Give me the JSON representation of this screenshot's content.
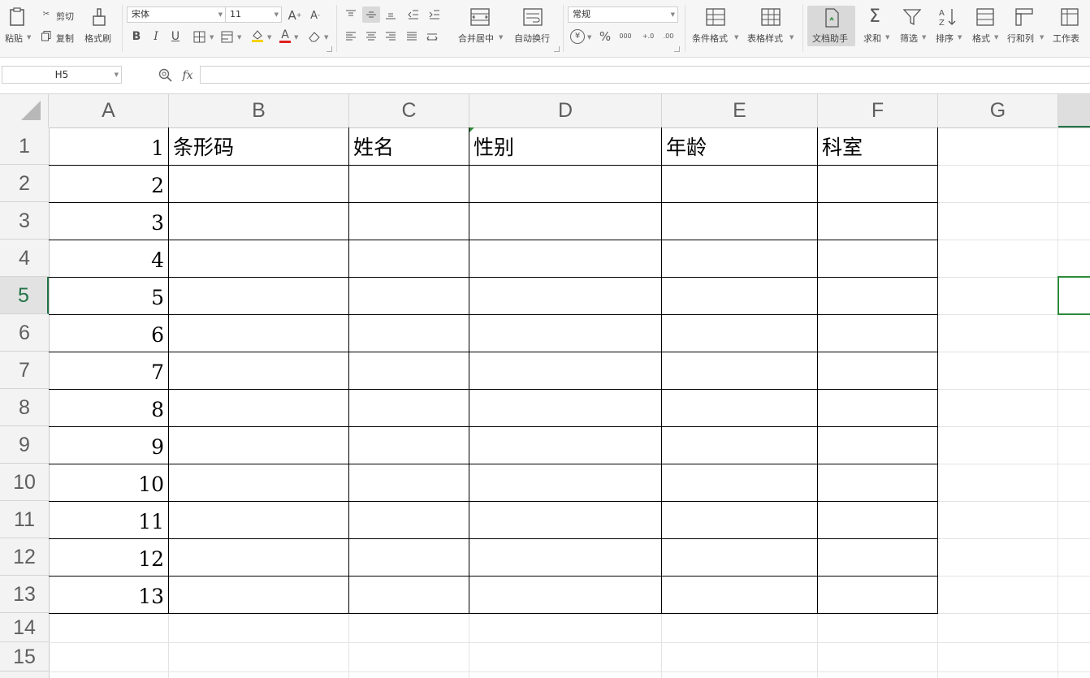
{
  "ribbon": {
    "clipboard": {
      "paste": "粘贴",
      "cut": "剪切",
      "copy": "复制",
      "format_painter": "格式刷"
    },
    "font": {
      "name": "宋体",
      "size": "11",
      "bold": "B",
      "italic": "I",
      "underline": "U",
      "font_color_letter": "A"
    },
    "alignment": {
      "merge_center": "合并居中",
      "wrap_text": "自动换行"
    },
    "number": {
      "format": "常规",
      "currency": "¥",
      "percent": "%",
      "thousands": "000",
      "inc_decimal": "+.0",
      "dec_decimal": ".00"
    },
    "styles": {
      "conditional_format": "条件格式",
      "table_style": "表格样式"
    },
    "tools": {
      "doc_assistant": "文档助手",
      "sum": "求和",
      "filter": "筛选",
      "sort": "排序",
      "format": "格式",
      "rows_cols": "行和列",
      "worksheet": "工作表"
    }
  },
  "formula_bar": {
    "cell_ref": "H5",
    "fx": "fx",
    "value": ""
  },
  "columns": [
    "A",
    "B",
    "C",
    "D",
    "E",
    "F",
    "G"
  ],
  "rows": [
    "1",
    "2",
    "3",
    "4",
    "5",
    "6",
    "7",
    "8",
    "9",
    "10",
    "11",
    "12",
    "13",
    "14",
    "15"
  ],
  "selected_row": "5",
  "selected_cell": "H5",
  "cells": {
    "A": [
      "1",
      "2",
      "3",
      "4",
      "5",
      "6",
      "7",
      "8",
      "9",
      "10",
      "11",
      "12",
      "13"
    ],
    "headers": {
      "B1": "条形码",
      "C1": "姓名",
      "D1": "性别",
      "E1": "年龄",
      "F1": "科室"
    }
  },
  "colors": {
    "accent_green": "#217346",
    "selection_green": "#2e8b3a",
    "ribbon_bg": "#f6f6f6"
  }
}
